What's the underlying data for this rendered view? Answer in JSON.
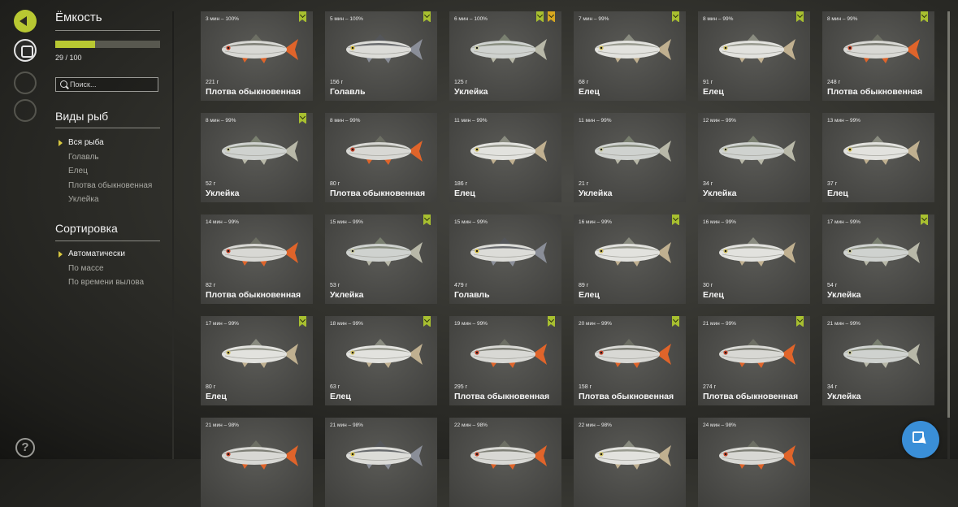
{
  "sidebar": {
    "capacity_title": "Ёмкость",
    "capacity_text": "29 / 100",
    "capacity_fraction": 0.29,
    "search_placeholder": "Поиск...",
    "species_title": "Виды рыб",
    "species": [
      {
        "label": "Вся рыба",
        "selected": true
      },
      {
        "label": "Голавль",
        "selected": false
      },
      {
        "label": "Елец",
        "selected": false
      },
      {
        "label": "Плотва обыкновенная",
        "selected": false
      },
      {
        "label": "Уклейка",
        "selected": false
      }
    ],
    "sort_title": "Сортировка",
    "sort": [
      {
        "label": "Автоматически",
        "selected": true
      },
      {
        "label": "По массе",
        "selected": false
      },
      {
        "label": "По времени вылова",
        "selected": false
      }
    ]
  },
  "icons": {
    "collapse": "collapse-panel-icon",
    "keepnet": "keepnet-icon",
    "help": "?",
    "fab": "cursor-pointer-icon"
  },
  "colors": {
    "accent": "#b8c832",
    "badge_gold": "#d8a820",
    "fab": "#3a8fd8"
  },
  "fish": [
    {
      "caught": "3 мин – 100%",
      "weight": "221 г",
      "name": "Плотва обыкновенная",
      "kind": "roach",
      "badges": [
        "green"
      ]
    },
    {
      "caught": "5 мин – 100%",
      "weight": "156 г",
      "name": "Голавль",
      "kind": "chub",
      "badges": [
        "green"
      ]
    },
    {
      "caught": "6 мин – 100%",
      "weight": "125 г",
      "name": "Уклейка",
      "kind": "bleak",
      "badges": [
        "green",
        "gold"
      ]
    },
    {
      "caught": "7 мин – 99%",
      "weight": "68 г",
      "name": "Елец",
      "kind": "dace",
      "badges": [
        "green"
      ]
    },
    {
      "caught": "8 мин – 99%",
      "weight": "91 г",
      "name": "Елец",
      "kind": "dace",
      "badges": [
        "green"
      ]
    },
    {
      "caught": "8 мин – 99%",
      "weight": "248 г",
      "name": "Плотва обыкновенная",
      "kind": "roach",
      "badges": [
        "green"
      ]
    },
    {
      "caught": "8 мин – 99%",
      "weight": "52 г",
      "name": "Уклейка",
      "kind": "bleak",
      "badges": [
        "green"
      ]
    },
    {
      "caught": "8 мин – 99%",
      "weight": "80 г",
      "name": "Плотва обыкновенная",
      "kind": "roach",
      "badges": []
    },
    {
      "caught": "11 мин – 99%",
      "weight": "186 г",
      "name": "Елец",
      "kind": "dace",
      "badges": []
    },
    {
      "caught": "11 мин – 99%",
      "weight": "21 г",
      "name": "Уклейка",
      "kind": "bleak",
      "badges": []
    },
    {
      "caught": "12 мин – 99%",
      "weight": "34 г",
      "name": "Уклейка",
      "kind": "bleak",
      "badges": []
    },
    {
      "caught": "13 мин – 99%",
      "weight": "37 г",
      "name": "Елец",
      "kind": "dace",
      "badges": []
    },
    {
      "caught": "14 мин – 99%",
      "weight": "82 г",
      "name": "Плотва обыкновенная",
      "kind": "roach",
      "badges": []
    },
    {
      "caught": "15 мин – 99%",
      "weight": "53 г",
      "name": "Уклейка",
      "kind": "bleak",
      "badges": [
        "green"
      ]
    },
    {
      "caught": "15 мин – 99%",
      "weight": "479 г",
      "name": "Голавль",
      "kind": "chub",
      "badges": []
    },
    {
      "caught": "16 мин – 99%",
      "weight": "89 г",
      "name": "Елец",
      "kind": "dace",
      "badges": [
        "green"
      ]
    },
    {
      "caught": "16 мин – 99%",
      "weight": "30 г",
      "name": "Елец",
      "kind": "dace",
      "badges": []
    },
    {
      "caught": "17 мин – 99%",
      "weight": "54 г",
      "name": "Уклейка",
      "kind": "bleak",
      "badges": [
        "green"
      ]
    },
    {
      "caught": "17 мин – 99%",
      "weight": "80 г",
      "name": "Елец",
      "kind": "dace",
      "badges": [
        "green"
      ]
    },
    {
      "caught": "18 мин – 99%",
      "weight": "63 г",
      "name": "Елец",
      "kind": "dace",
      "badges": [
        "green"
      ]
    },
    {
      "caught": "19 мин – 99%",
      "weight": "295 г",
      "name": "Плотва обыкновенная",
      "kind": "roach",
      "badges": [
        "green"
      ]
    },
    {
      "caught": "20 мин – 99%",
      "weight": "158 г",
      "name": "Плотва обыкновенная",
      "kind": "roach",
      "badges": [
        "green"
      ]
    },
    {
      "caught": "21 мин – 99%",
      "weight": "274 г",
      "name": "Плотва обыкновенная",
      "kind": "roach",
      "badges": [
        "green"
      ]
    },
    {
      "caught": "21 мин – 99%",
      "weight": "34 г",
      "name": "Уклейка",
      "kind": "bleak",
      "badges": []
    },
    {
      "caught": "21 мин – 98%",
      "weight": "",
      "name": "",
      "kind": "roach",
      "badges": []
    },
    {
      "caught": "21 мин – 98%",
      "weight": "",
      "name": "",
      "kind": "chub",
      "badges": []
    },
    {
      "caught": "22 мин – 98%",
      "weight": "",
      "name": "",
      "kind": "roach",
      "badges": []
    },
    {
      "caught": "22 мин – 98%",
      "weight": "",
      "name": "",
      "kind": "dace",
      "badges": []
    },
    {
      "caught": "24 мин – 98%",
      "weight": "",
      "name": "",
      "kind": "roach",
      "badges": []
    }
  ]
}
